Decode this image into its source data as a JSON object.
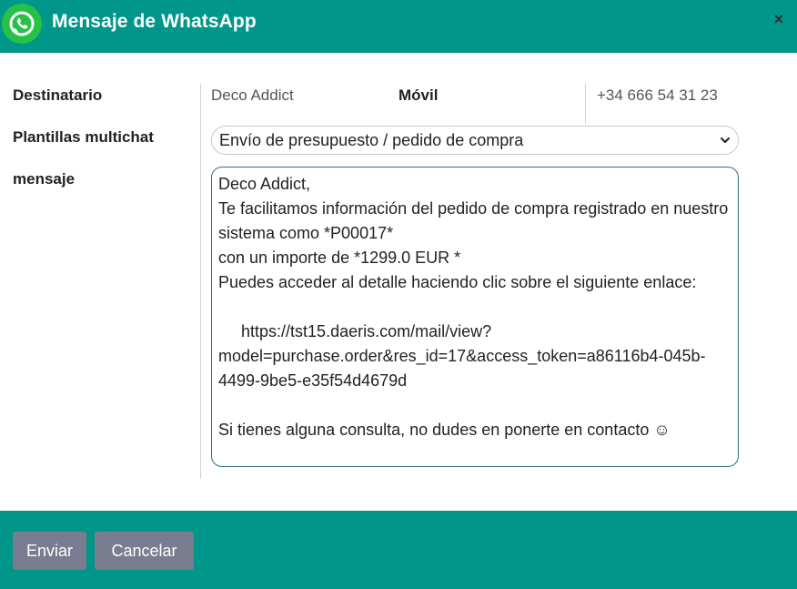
{
  "dialog": {
    "title": "Mensaje de WhatsApp",
    "close_glyph": "×",
    "logo_icon": "whatsapp-icon",
    "accent_color": "#00968a"
  },
  "form": {
    "recipient_label": "Destinatario",
    "recipient_name": "Deco Addict",
    "mobile_label": "Móvil",
    "mobile_value": "+34 666 54 31 23",
    "templates_label": "Plantillas multichat",
    "template_selected": "Envío de presupuesto / pedido de compra",
    "message_label": "mensaje",
    "message_text": "Deco Addict,\nTe facilitamos información del pedido de compra registrado en nuestro sistema como *P00017*\ncon un importe de *1299.0 EUR *\nPuedes acceder al detalle haciendo clic sobre el siguiente enlace:\n\n     https://tst15.daeris.com/mail/view?model=purchase.order&res_id=17&access_token=a86116b4-045b-4499-9be5-e35f54d4679d\n\nSi tienes alguna consulta, no dudes en ponerte en contacto ☺"
  },
  "footer": {
    "send_label": "Enviar",
    "cancel_label": "Cancelar",
    "button_color": "#7a7d8f"
  }
}
